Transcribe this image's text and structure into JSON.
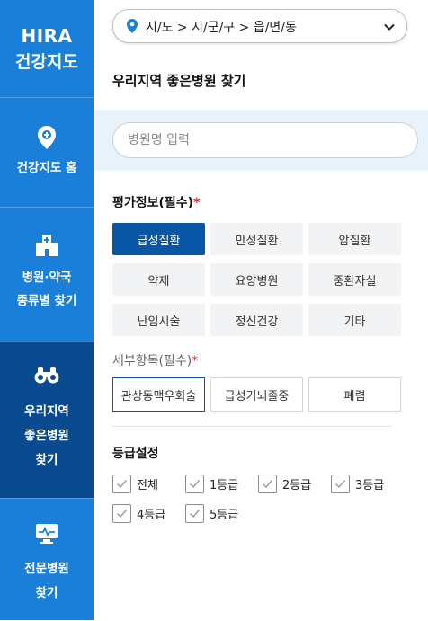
{
  "sidebar": {
    "logo_line1": "HIRA",
    "logo_line2": "건강지도",
    "items": [
      {
        "label_lines": [
          "건강지도 홈"
        ],
        "icon": "map-pin-plus-icon"
      },
      {
        "label_lines": [
          "병원·약국",
          "종류별 찾기"
        ],
        "icon": "hospital-building-icon"
      },
      {
        "label_lines": [
          "우리지역",
          "좋은병원",
          "찾기"
        ],
        "icon": "binoculars-icon",
        "active": true
      },
      {
        "label_lines": [
          "전문병원",
          "찾기"
        ],
        "icon": "monitor-heartbeat-icon"
      }
    ]
  },
  "location": {
    "breadcrumb": "시/도 > 시/군/구 > 읍/면/동"
  },
  "main": {
    "title": "우리지역 좋은병원 찾기",
    "search_placeholder": "병원명 입력"
  },
  "evaluation": {
    "label": "평가정보(필수)",
    "required_mark": "*",
    "options": [
      "급성질환",
      "만성질환",
      "암질환",
      "약제",
      "요양병원",
      "중환자실",
      "난임시술",
      "정신건강",
      "기타"
    ],
    "selected_index": 0
  },
  "detail": {
    "label": "세부항목(필수)",
    "required_mark": "*",
    "options": [
      "관상동맥우회술",
      "급성기뇌졸중",
      "폐렴"
    ],
    "selected_index": 0
  },
  "grade": {
    "label": "등급설정",
    "options": [
      "전체",
      "1등급",
      "2등급",
      "3등급",
      "4등급",
      "5등급"
    ]
  },
  "colors": {
    "sidebar": "#1a7fd8",
    "sidebar_active": "#0a4a8f",
    "selected_button": "#0a56a6",
    "required": "#e02020"
  }
}
